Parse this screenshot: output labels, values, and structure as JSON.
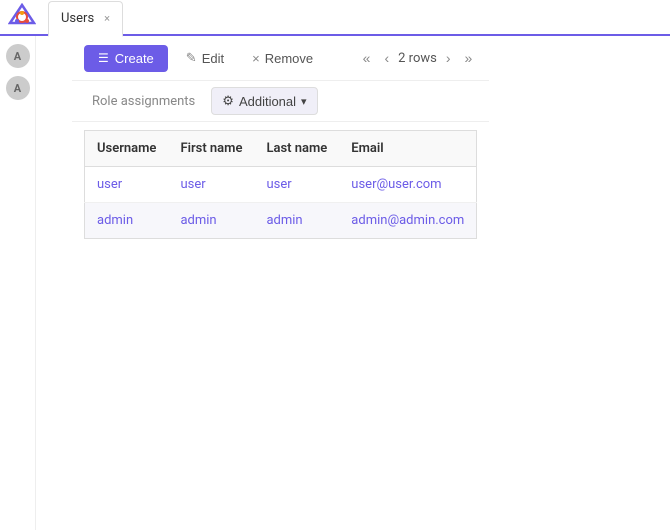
{
  "topBar": {
    "tab": {
      "label": "Users",
      "close": "×"
    }
  },
  "sidebar": {
    "items": [
      {
        "label": "A"
      },
      {
        "label": "A"
      }
    ]
  },
  "toolbar": {
    "createLabel": "Create",
    "editLabel": "Edit",
    "removeLabel": "Remove",
    "rowCount": "2 rows"
  },
  "subToolbar": {
    "roleAssignmentsLabel": "Role assignments",
    "additionalLabel": "Additional"
  },
  "table": {
    "columns": [
      {
        "key": "username",
        "label": "Username"
      },
      {
        "key": "firstName",
        "label": "First name"
      },
      {
        "key": "lastName",
        "label": "Last name"
      },
      {
        "key": "email",
        "label": "Email"
      }
    ],
    "rows": [
      {
        "username": "user",
        "firstName": "user",
        "lastName": "user",
        "email": "user@user.com"
      },
      {
        "username": "admin",
        "firstName": "admin",
        "lastName": "admin",
        "email": "admin@admin.com"
      }
    ]
  },
  "icons": {
    "create": "☰",
    "edit": "✎",
    "remove": "×",
    "gear": "⚙",
    "chevronDown": "▾",
    "pageFirst": "«",
    "pagePrev": "‹",
    "pageNext": "›",
    "pageLast": "»"
  }
}
